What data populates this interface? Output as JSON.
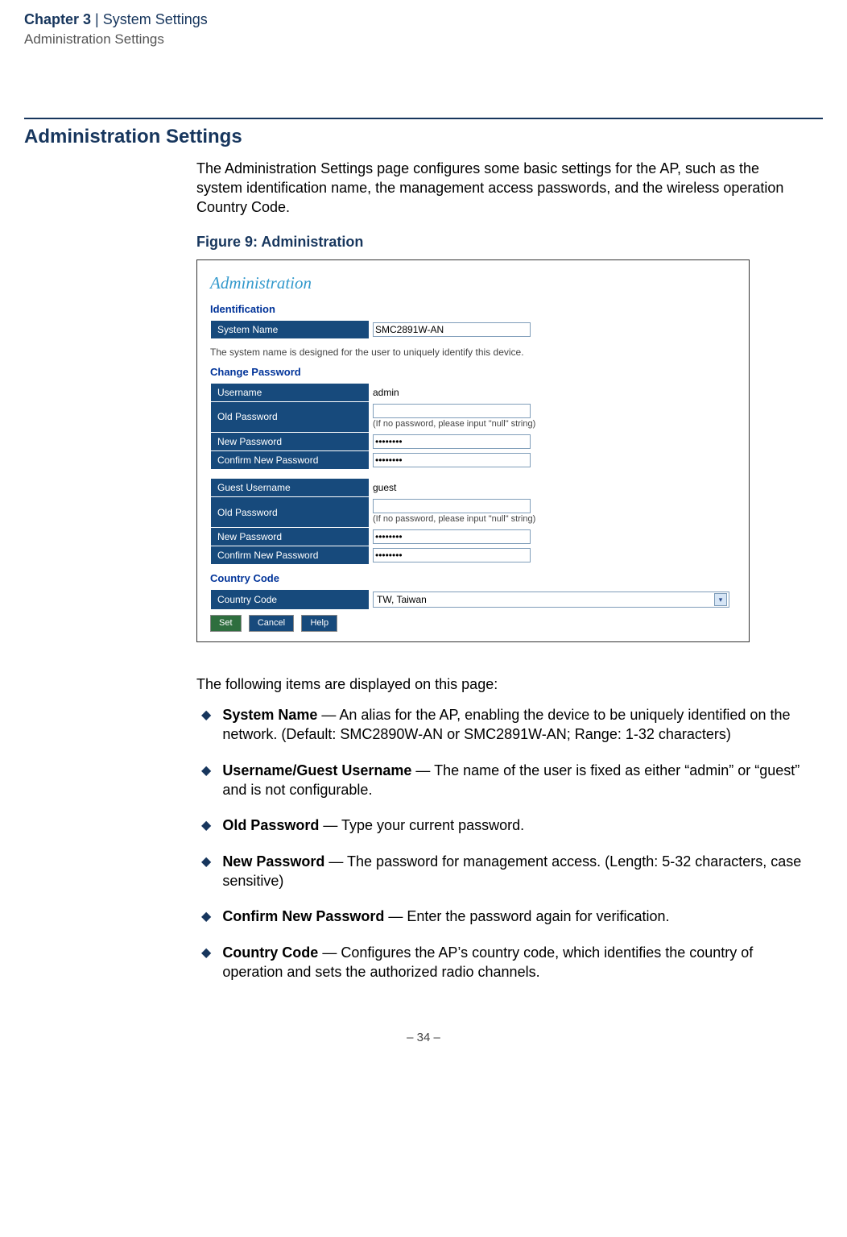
{
  "header": {
    "chapter": "Chapter 3",
    "separator": "|",
    "title": "System Settings",
    "subtitle": "Administration Settings"
  },
  "section": {
    "heading": "Administration Settings",
    "intro": "The Administration Settings page configures some basic settings for the AP, such as the system identification name, the management access passwords, and the wireless operation Country Code.",
    "figure_caption": "Figure 9:  Administration"
  },
  "screenshot": {
    "title": "Administration",
    "identification": {
      "heading": "Identification",
      "system_name_label": "System Name",
      "system_name_value": "SMC2891W-AN",
      "note": "The system name is designed for the user to uniquely identify this device."
    },
    "change_password": {
      "heading": "Change Password",
      "username_label": "Username",
      "username_value": "admin",
      "old_password_label": "Old Password",
      "old_password_hint": "(If no password, please input \"null\" string)",
      "new_password_label": "New Password",
      "new_password_value": "••••••••",
      "confirm_label": "Confirm New Password",
      "confirm_value": "••••••••",
      "guest_username_label": "Guest Username",
      "guest_username_value": "guest",
      "guest_old_password_label": "Old Password",
      "guest_old_password_hint": "(If no password, please input \"null\" string)",
      "guest_new_password_label": "New Password",
      "guest_new_password_value": "••••••••",
      "guest_confirm_label": "Confirm New Password",
      "guest_confirm_value": "••••••••"
    },
    "country_code": {
      "heading": "Country Code",
      "label": "Country Code",
      "value": "TW, Taiwan"
    },
    "buttons": {
      "set": "Set",
      "cancel": "Cancel",
      "help": "Help"
    }
  },
  "items_intro": "The following items are displayed on this page:",
  "bullets": [
    {
      "term": "System Name",
      "desc": " — An alias for the AP, enabling the device to be uniquely identified on the network. (Default: SMC2890W-AN or SMC2891W-AN; Range: 1-32 characters)"
    },
    {
      "term": "Username/Guest Username",
      "desc": " — The name of the user is fixed as either “admin” or “guest” and is not configurable."
    },
    {
      "term": "Old Password",
      "desc": " — Type your current password."
    },
    {
      "term": "New Password",
      "desc": " — The password for management access. (Length: 5-32 characters, case sensitive)"
    },
    {
      "term": "Confirm New Password",
      "desc": " — Enter the password again for verification."
    },
    {
      "term": "Country Code",
      "desc": " — Configures the AP’s country code, which identifies the country of operation and sets the authorized radio channels."
    }
  ],
  "footer": "–  34  –"
}
